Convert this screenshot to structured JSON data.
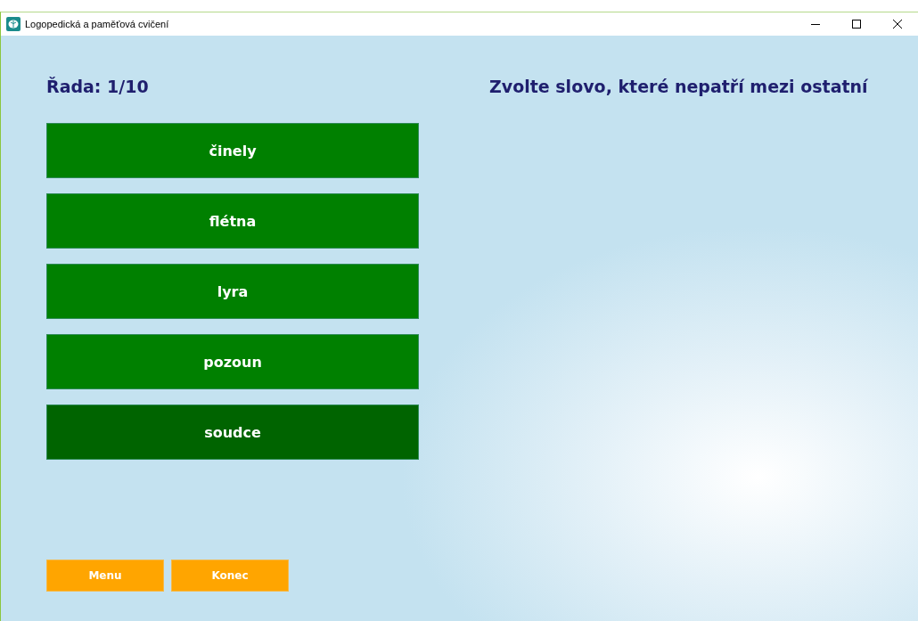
{
  "window": {
    "title": "Logopedická a paměťová cvičení"
  },
  "round": "Řada: 1/10",
  "instruction": "Zvolte slovo, které nepatří mezi ostatní",
  "words": [
    {
      "label": "činely",
      "hovered": false
    },
    {
      "label": "flétna",
      "hovered": false
    },
    {
      "label": "lyra",
      "hovered": false
    },
    {
      "label": "pozoun",
      "hovered": false
    },
    {
      "label": "soudce",
      "hovered": true
    }
  ],
  "buttons": [
    "Menu",
    "Konec"
  ]
}
